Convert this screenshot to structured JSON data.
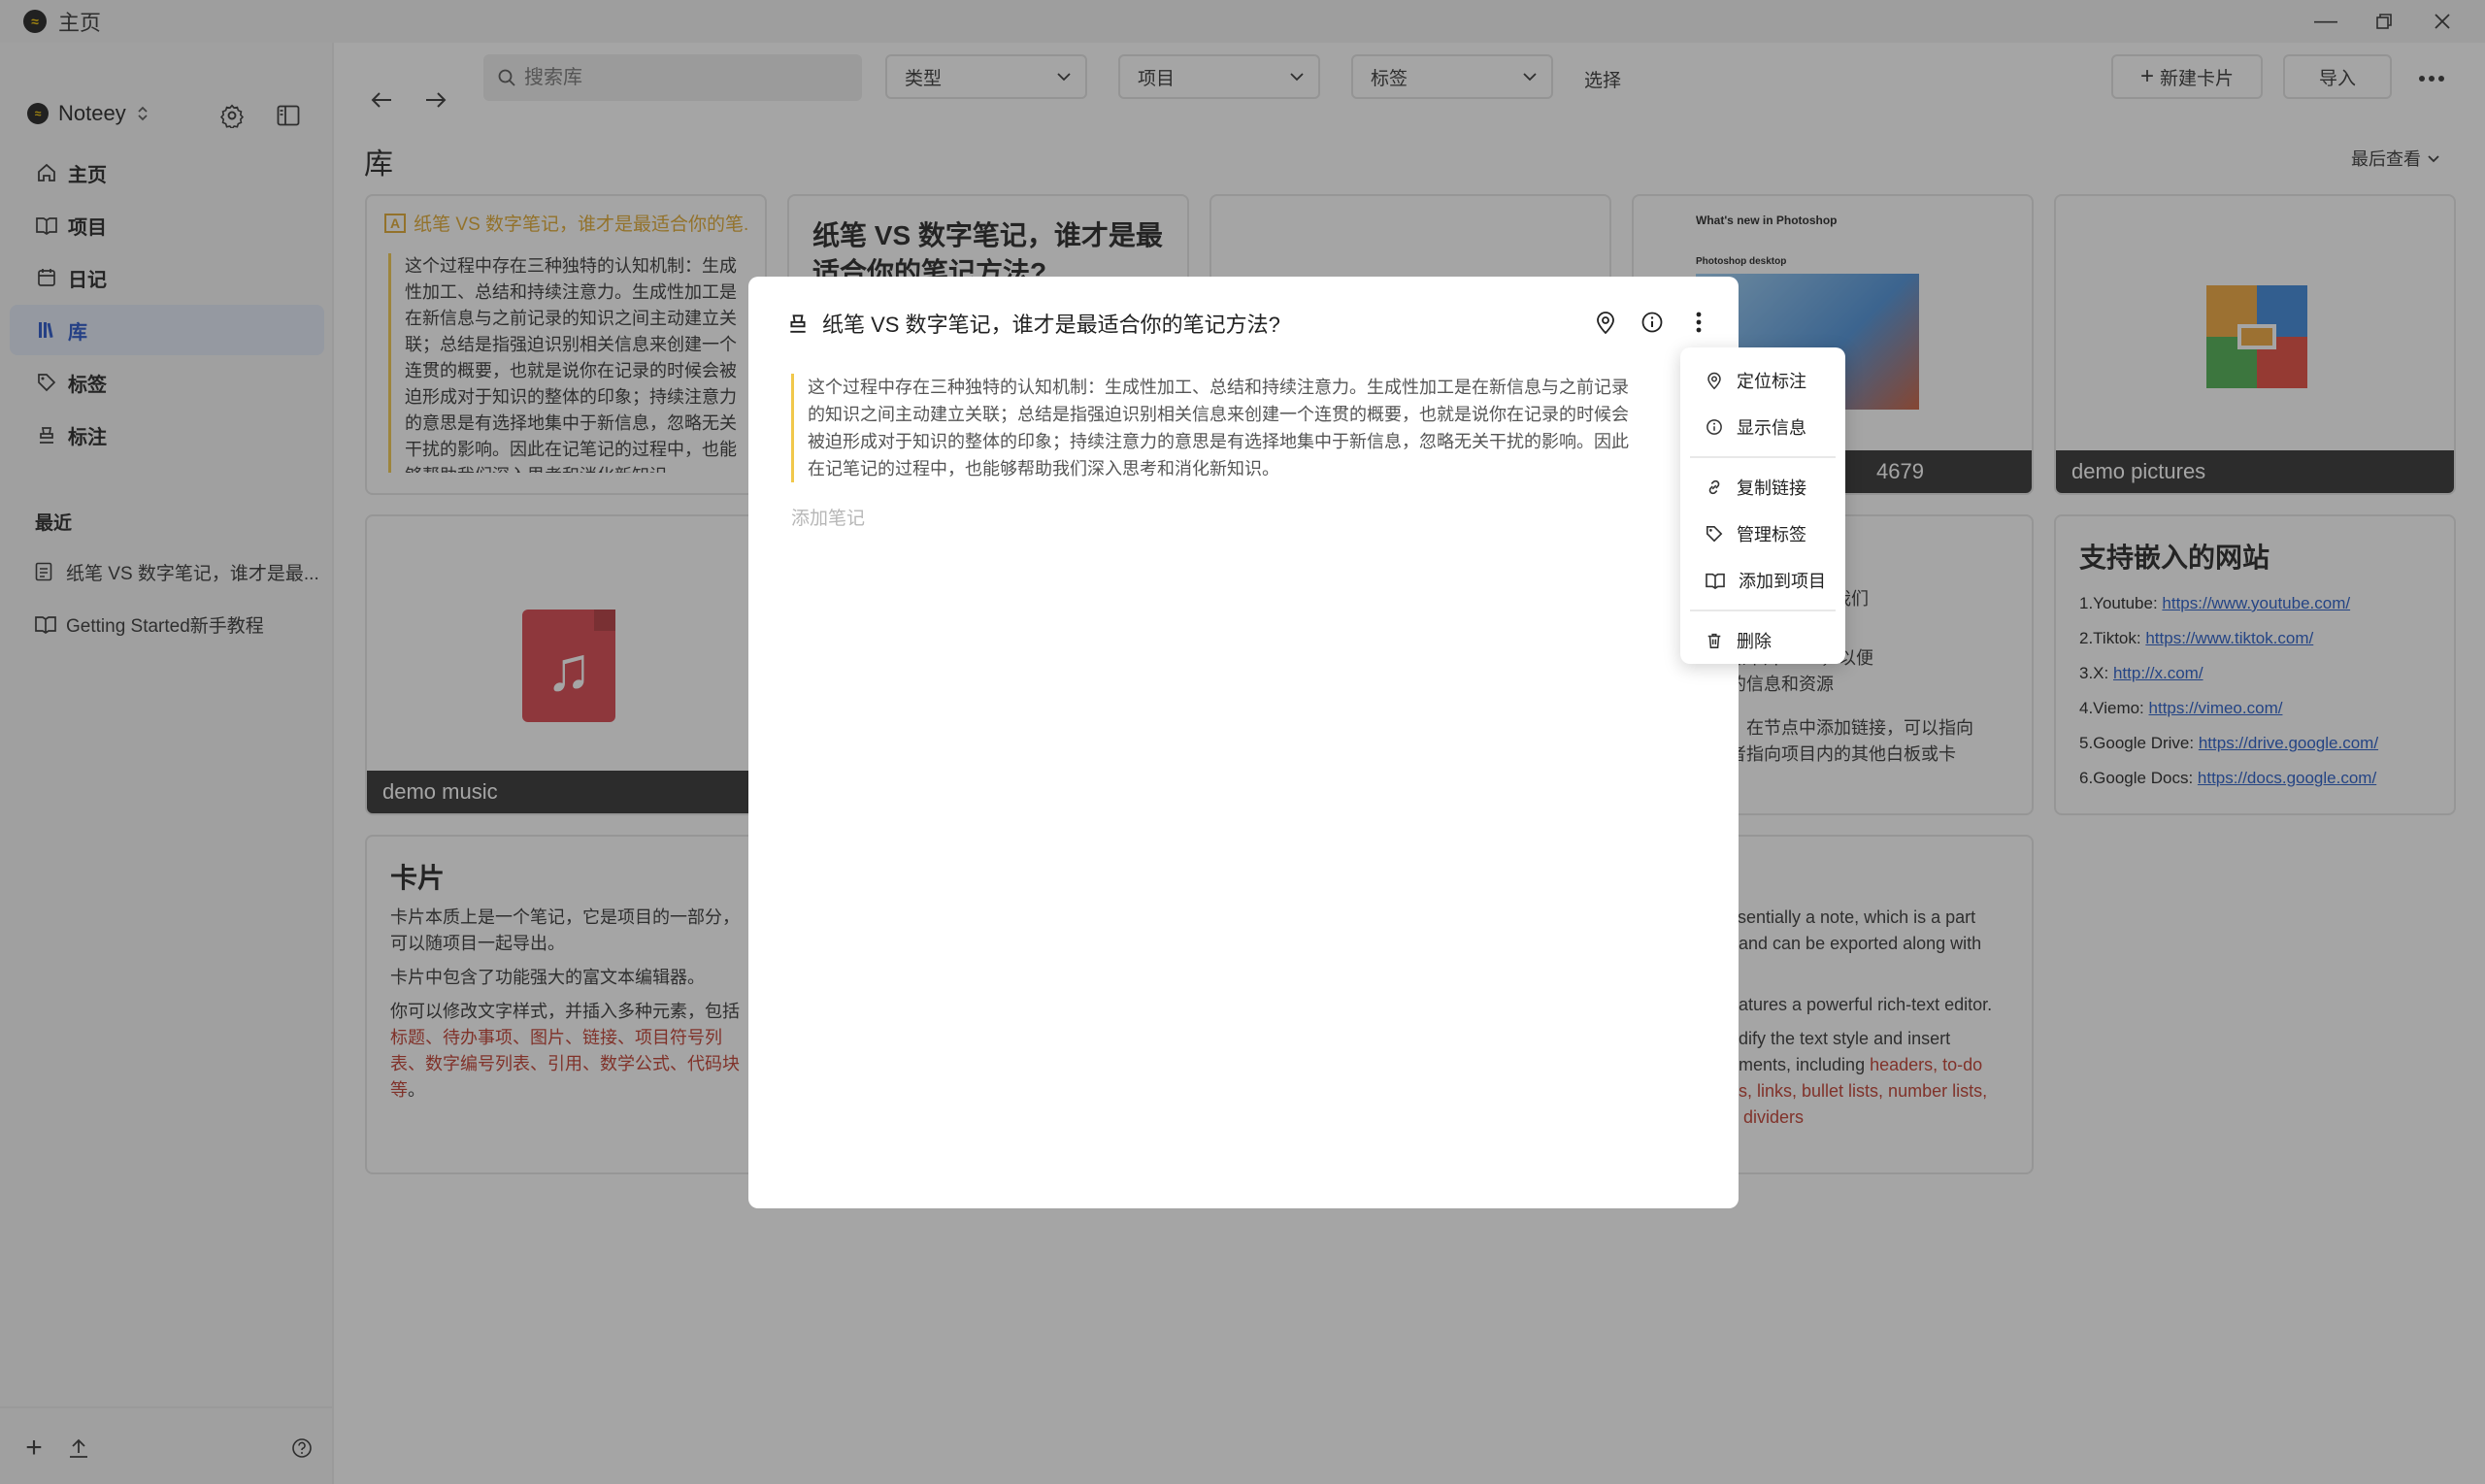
{
  "window": {
    "title": "主页"
  },
  "sidebar": {
    "workspace": "Noteey",
    "nav": [
      {
        "label": "主页",
        "icon": "home-icon"
      },
      {
        "label": "项目",
        "icon": "book-icon"
      },
      {
        "label": "日记",
        "icon": "calendar-icon"
      },
      {
        "label": "库",
        "icon": "library-icon",
        "active": true
      },
      {
        "label": "标签",
        "icon": "tag-icon"
      },
      {
        "label": "标注",
        "icon": "highlighter-icon"
      }
    ],
    "recent_label": "最近",
    "recent": [
      {
        "label": "纸笔 VS 数字笔记，谁才是最...",
        "icon": "document-icon"
      },
      {
        "label": "Getting Started新手教程",
        "icon": "book-icon"
      }
    ]
  },
  "toolbar": {
    "search_placeholder": "搜索库",
    "filter_type": "类型",
    "filter_project": "项目",
    "filter_tags": "标签",
    "select": "选择",
    "new_card": "新建卡片",
    "import": "导入"
  },
  "library": {
    "title": "库",
    "sort": "最后查看",
    "cards": {
      "c1_title": "纸笔 VS 数字笔记，谁才是最适合你的笔...",
      "c1_text": "这个过程中存在三种独特的认知机制：生成性加工、总结和持续注意力。生成性加工是在新信息与之前记录的知识之间主动建立关联；总结是指强迫识别相关信息来创建一个连贯的概要，也就是说你在记录的时候会被迫形成对于知识的整体的印象；持续注意力的意思是有选择地集中于新信息，忽略无关干扰的影响。因此在记笔记的过程中，也能够帮助我们深入思考和消化新知识。",
      "c2_title": "纸笔 VS 数字笔记，谁才是最适合你的笔记方法?",
      "c4_caption": "4679",
      "c4_heading": "What's new in Photoshop",
      "c4_sub": "Photoshop desktop",
      "c5_caption": "demo pictures",
      "music_caption": "demo music",
      "right_text_1": "视觉组织工具，我们",
      "right_text_2": "添加卡片/PDF，以便",
      "right_text_3": "多的信息和资源",
      "right_text_4": "合：在节点中添加链接，可以指向",
      "right_text_5": "或者指向项目内的其他白板或卡",
      "embed_title": "支持嵌入的网站",
      "embed_links": [
        {
          "prefix": "1.Youtube: ",
          "url": "https://www.youtube.com/"
        },
        {
          "prefix": "2.Tiktok: ",
          "url": "https://www.tiktok.com/"
        },
        {
          "prefix": "3.X: ",
          "url": "http://x.com/"
        },
        {
          "prefix": "4.Viemo: ",
          "url": "https://vimeo.com/"
        },
        {
          "prefix": "5.Google Drive: ",
          "url": "https://drive.google.com/"
        },
        {
          "prefix": "6.Google Docs: ",
          "url": "https://docs.google.com/"
        }
      ],
      "cards_title": "卡片",
      "cards_p1": "卡片本质上是一个笔记，它是项目的一部分，可以随项目一起导出。",
      "cards_p2": "卡片中包含了功能强大的富文本编辑器。",
      "cards_p3": "你可以修改文字样式，并插入多种元素，包括",
      "cards_p3_red": "标题、待办事项、图片、链接、项目符号列表、数字编号列表、引用、数学公式、代码块等",
      "cards_p3_end": "。",
      "en_p1": "ssentially a note, which is a part",
      "en_p1b": "t and can be exported along with",
      "en_p2": "eatures a powerful rich-text editor.",
      "en_p3": "odify the text style and insert",
      "en_p3b": "ements, including ",
      "en_red1": "headers, to-do",
      "en_red2": "es, links, bullet lists, number lists,",
      "en_red3": "d dividers"
    }
  },
  "modal": {
    "title": "纸笔 VS 数字笔记，谁才是最适合你的笔记方法?",
    "quote": "这个过程中存在三种独特的认知机制：生成性加工、总结和持续注意力。生成性加工是在新信息与之前记录的知识之间主动建立关联；总结是指强迫识别相关信息来创建一个连贯的概要，也就是说你在记录的时候会被迫形成对于知识的整体的印象；持续注意力的意思是有选择地集中于新信息，忽略无关干扰的影响。因此在记笔记的过程中，也能够帮助我们深入思考和消化新知识。",
    "add_note_placeholder": "添加笔记"
  },
  "context_menu": {
    "locate": "定位标注",
    "info": "显示信息",
    "copy_link": "复制链接",
    "manage_tags": "管理标签",
    "add_to_project": "添加到项目",
    "delete": "删除"
  }
}
